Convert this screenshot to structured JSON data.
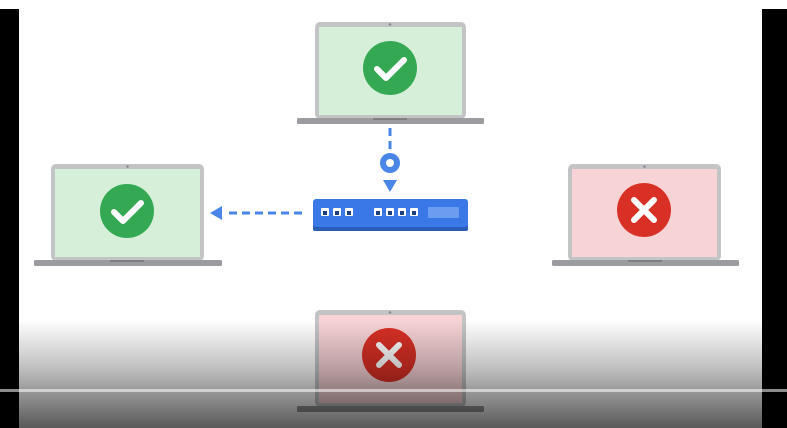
{
  "colors": {
    "ok_screen": "#d6efd9",
    "ok_badge": "#34a853",
    "fail_screen": "#f7d3d6",
    "fail_badge": "#d93025",
    "laptop_frame": "#c3c4c6",
    "laptop_base": "#9a9c9f",
    "switch_body": "#3b78e7",
    "switch_port": "#ffffff",
    "arrow": "#4a86e8",
    "node": "#4a86e8"
  },
  "diagram": {
    "nodes": [
      {
        "id": "laptop-top",
        "status": "allowed",
        "icon": "checkmark-icon"
      },
      {
        "id": "laptop-left",
        "status": "allowed",
        "icon": "checkmark-icon"
      },
      {
        "id": "laptop-right",
        "status": "blocked",
        "icon": "x-mark-icon"
      },
      {
        "id": "laptop-bottom",
        "status": "blocked",
        "icon": "x-mark-icon"
      }
    ],
    "switch": {
      "icon": "network-switch-icon",
      "port_groups": [
        3,
        4
      ],
      "uplink_module": true
    },
    "edges": [
      {
        "from": "laptop-top",
        "to": "switch",
        "style": "dashed",
        "arrow": true
      },
      {
        "from": "switch",
        "to": "laptop-left",
        "style": "dashed",
        "arrow": true
      }
    ]
  }
}
